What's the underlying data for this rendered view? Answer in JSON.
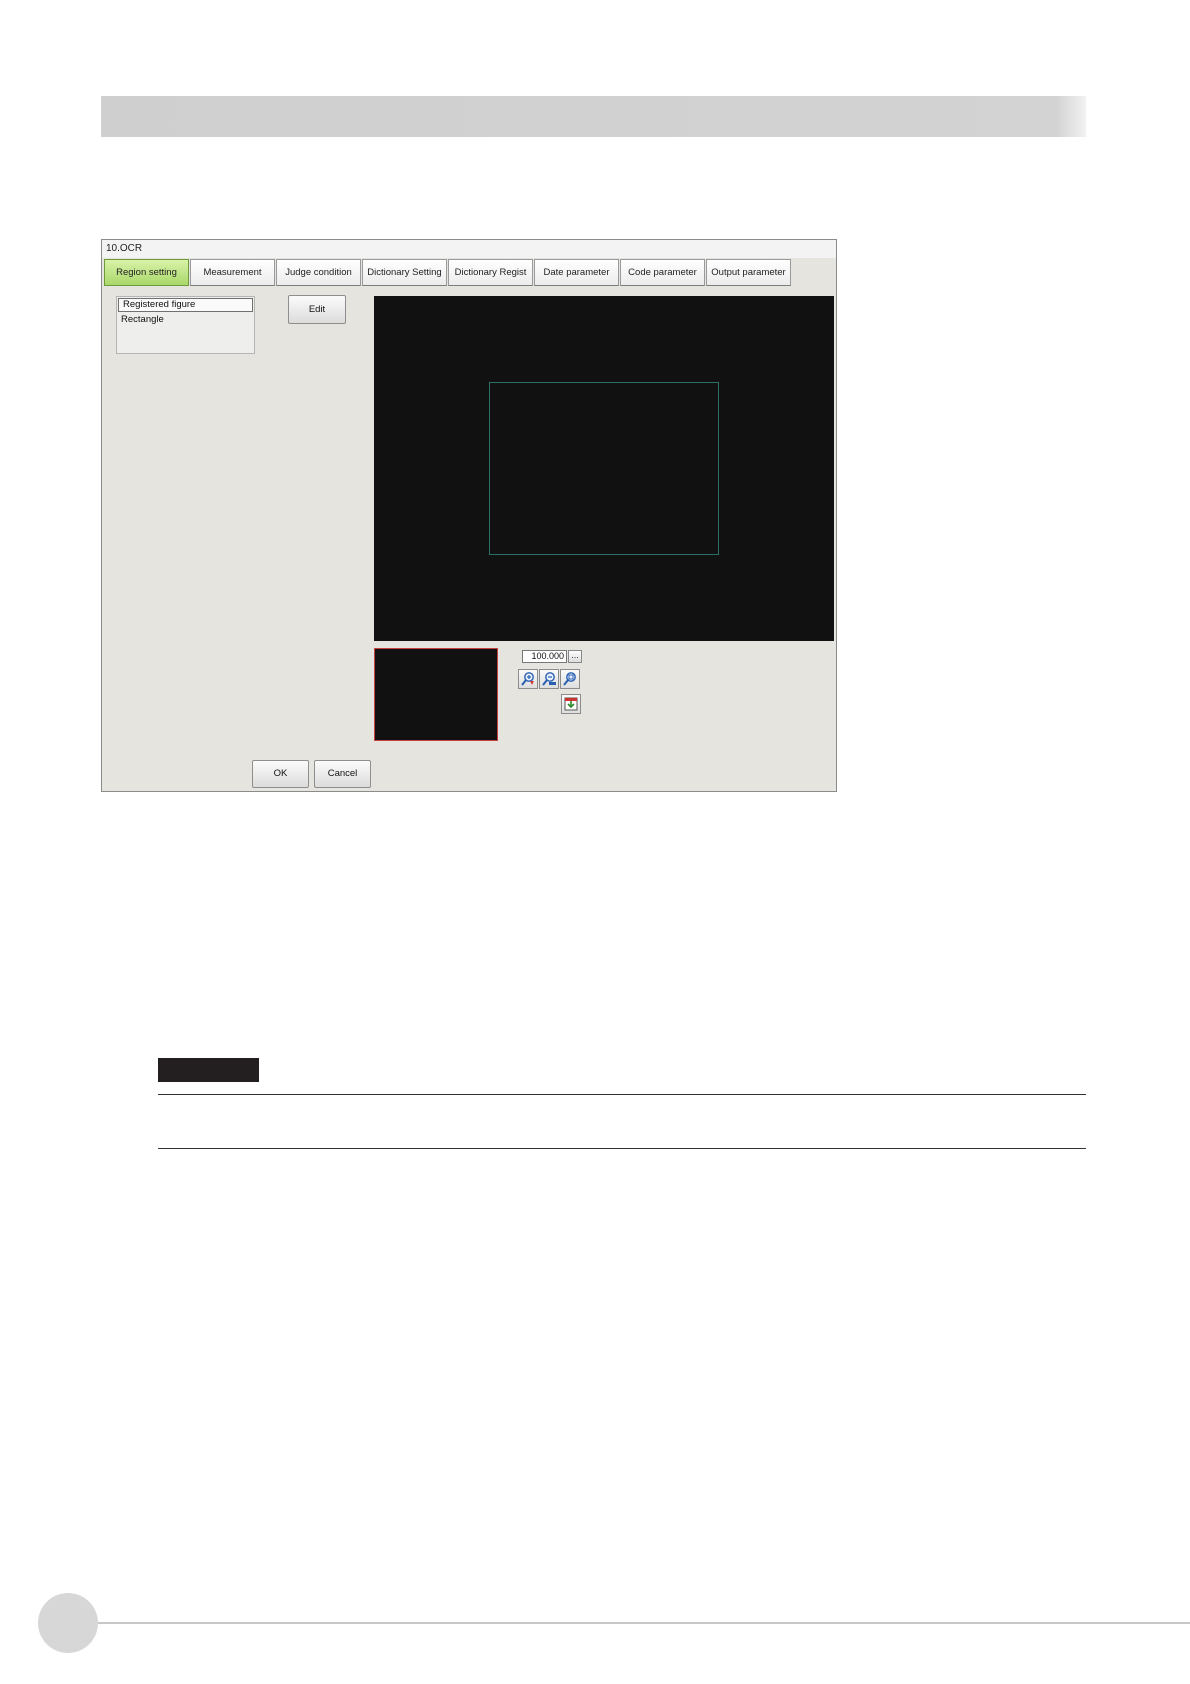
{
  "window": {
    "title": "10.OCR",
    "tabs": [
      {
        "label": "Region setting",
        "active": true
      },
      {
        "label": "Measurement",
        "active": false
      },
      {
        "label": "Judge condition",
        "active": false
      },
      {
        "label": "Dictionary Setting",
        "active": false
      },
      {
        "label": "Dictionary Regist",
        "active": false
      },
      {
        "label": "Date parameter",
        "active": false
      },
      {
        "label": "Code parameter",
        "active": false
      },
      {
        "label": "Output parameter",
        "active": false
      }
    ],
    "figure_list": {
      "header": "Registered figure",
      "items": [
        "Rectangle"
      ]
    },
    "edit_label": "Edit",
    "zoom": {
      "value": "100.000",
      "more_label": "..."
    },
    "ok_label": "OK",
    "cancel_label": "Cancel"
  },
  "colors": {
    "active_tab": "#b8e07a",
    "image_background": "#111111",
    "roi_outline": "#2d6f68",
    "thumbnail_border": "#c8403f"
  },
  "icons": [
    "zoom-in-icon",
    "zoom-out-icon",
    "zoom-fit-icon",
    "fit-window-icon"
  ]
}
